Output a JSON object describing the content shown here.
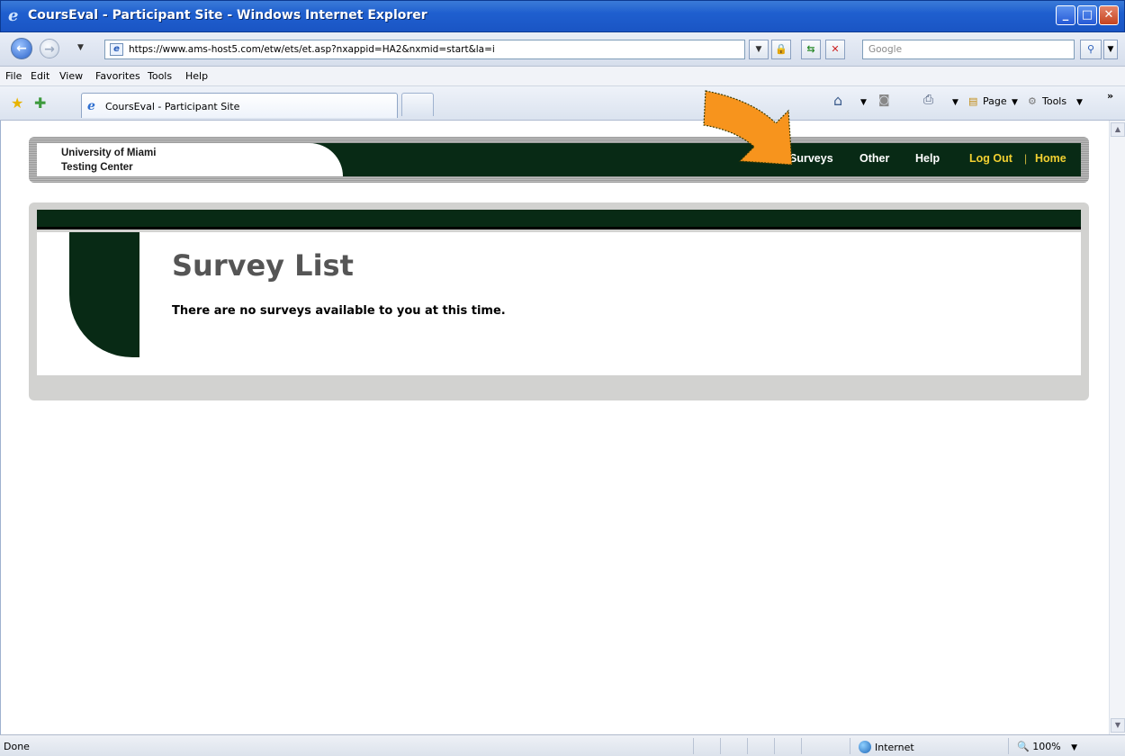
{
  "window": {
    "title": "CoursEval - Participant Site - Windows Internet Explorer",
    "minimize": "_",
    "maximize": "□",
    "close": "✕"
  },
  "address_bar": {
    "url": "https://www.ams-host5.com/etw/ets/et.asp?nxappid=HA2&nxmid=start&la=i",
    "search_placeholder": "Google"
  },
  "menu": {
    "items": [
      "File",
      "Edit",
      "View",
      "Favorites",
      "Tools",
      "Help"
    ]
  },
  "tabs": {
    "active_title": "CoursEval - Participant Site"
  },
  "command_bar": {
    "page_label": "Page",
    "tools_label": "Tools",
    "overflow": "»"
  },
  "site": {
    "org_line1": "University of Miami",
    "org_line2": "Testing Center",
    "nav": {
      "surveys": "Surveys",
      "other": "Other",
      "help": "Help",
      "logout": "Log Out",
      "separator": "|",
      "home": "Home"
    }
  },
  "main": {
    "title": "Survey List",
    "message": "There are no surveys available to you at this time."
  },
  "status_bar": {
    "status": "Done",
    "zone": "Internet",
    "zoom": "100%"
  },
  "colors": {
    "site_green": "#082a15",
    "nav_yellow": "#f2d031",
    "arrow_orange": "#f7941d",
    "titlebar_blue": "#1f5fcf"
  },
  "icons": [
    "ie-logo-icon",
    "back-icon",
    "forward-icon",
    "lock-icon",
    "refresh-icon",
    "stop-icon",
    "search-icon",
    "favorites-star-icon",
    "add-favorites-icon",
    "home-icon",
    "feeds-icon",
    "print-icon",
    "page-icon",
    "tools-gear-icon",
    "globe-icon",
    "zoom-icon",
    "orange-arrow-icon"
  ]
}
